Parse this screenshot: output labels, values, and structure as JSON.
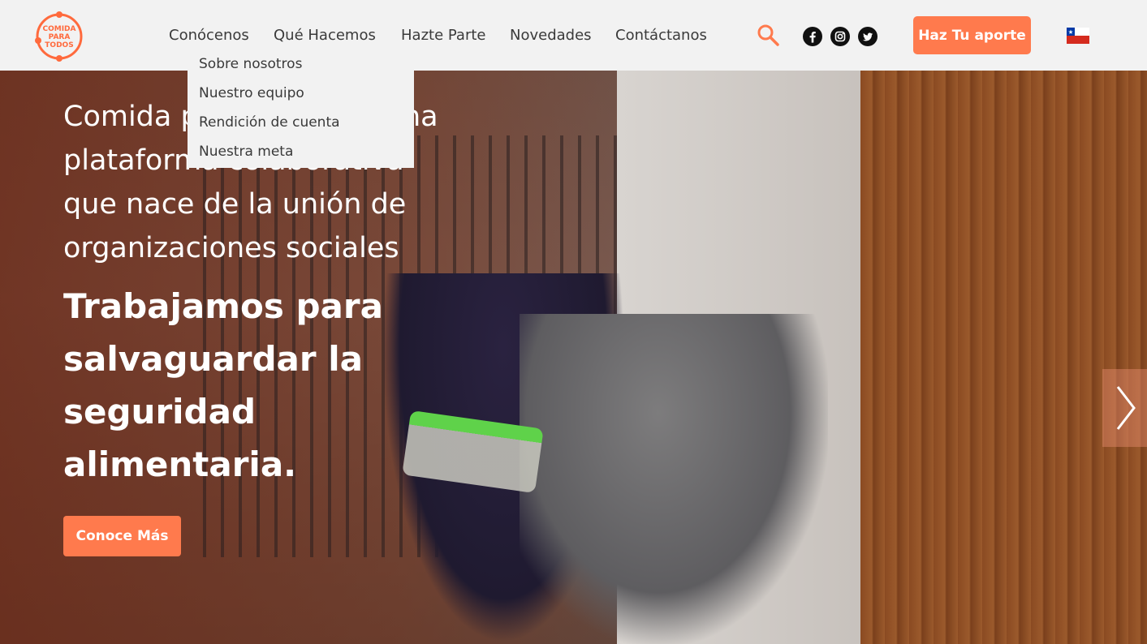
{
  "header": {
    "logo_text": [
      "COMIDA",
      "PARA",
      "TODOS"
    ],
    "nav": [
      "Conócenos",
      "Qué Hacemos",
      "Hazte Parte",
      "Novedades",
      "Contáctanos"
    ],
    "cta_label": "Haz Tu aporte"
  },
  "dropdown": {
    "items": [
      "Sobre nosotros",
      "Nuestro equipo",
      "Rendición de cuenta",
      "Nuestra meta"
    ]
  },
  "hero": {
    "intro": "Comida para Todos es una plataforma colaborativa que nace de la unión de organizaciones sociales",
    "title": "Trabajamos para salvaguardar la seguridad alimentaria.",
    "cta_label": "Conoce Más"
  },
  "icons": [
    "search-icon",
    "facebook-icon",
    "instagram-icon",
    "twitter-icon",
    "chile-flag-icon",
    "chevron-right-icon"
  ],
  "colors": {
    "accent": "#ff7a4d",
    "header_bg": "#f2f2f2",
    "nav_text": "#3a3a3a"
  }
}
